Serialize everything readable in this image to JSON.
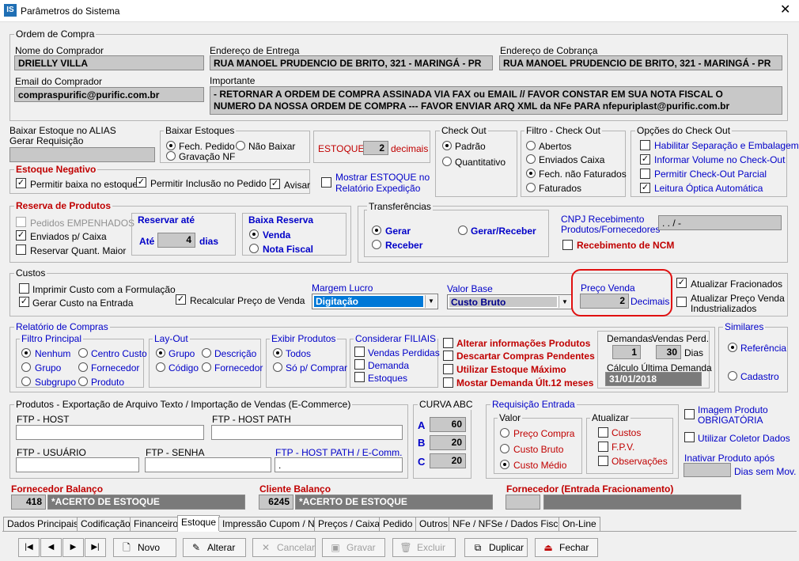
{
  "window": {
    "title": "Parâmetros do Sistema",
    "icon_text": "IS",
    "close": "✕"
  },
  "ordem_compra": {
    "title": "Ordem de Compra",
    "nome_label": "Nome do Comprador",
    "nome_value": "DRIELLY VILLA",
    "entrega_label": "Endereço de Entrega",
    "entrega_value": "RUA MANOEL PRUDENCIO DE BRITO, 321 - MARINGÁ - PR",
    "cobranca_label": "Endereço de Cobrança",
    "cobranca_value": "RUA MANOEL PRUDENCIO DE BRITO, 321 - MARINGÁ - PR",
    "email_label": "Email do Comprador",
    "email_value": "compraspurific@purific.com.br",
    "importante_label": "Importante",
    "importante_line1": "- RETORNAR A ORDEM DE COMPRA ASSINADA VIA FAX ou EMAIL //  FAVOR CONSTAR EM SUA NOTA FISCAL O",
    "importante_line2": "NUMERO DA NOSSA ORDEM DE COMPRA  ---  FAVOR ENVIAR ARQ XML da NFe PARA nfepuriplast@purific.com.br"
  },
  "baixar_alias": {
    "label1": "Baixar Estoque no ALIAS",
    "label2": "Gerar Requisição"
  },
  "baixar_estoques": {
    "title": "Baixar Estoques",
    "opt1": "Fech. Pedido",
    "opt2": "Não Baixar",
    "opt3": "Gravação NF"
  },
  "estoque": {
    "label": "ESTOQUE",
    "value": "2",
    "suffix": "decimais"
  },
  "checkout": {
    "title": "Check Out",
    "opt1": "Padrão",
    "opt2": "Quantitativo"
  },
  "filtro_checkout": {
    "title": "Filtro - Check Out",
    "opt1": "Abertos",
    "opt2": "Enviados Caixa",
    "opt3": "Fech. não Faturados",
    "opt4": "Faturados"
  },
  "opcoes_checkout": {
    "title": "Opções do Check Out",
    "opt1": "Habilitar Separação e Embalagem",
    "opt2": "Informar Volume no Check-Out",
    "opt3": "Permitir Check-Out Parcial",
    "opt4": "Leitura Óptica Automática"
  },
  "estoque_negativo": {
    "title": "Estoque Negativo",
    "opt1": "Permitir baixa no estoque",
    "opt2": "Permitir Inclusão no Pedido",
    "opt3": "Avisar"
  },
  "mostrar_estoque": {
    "line1": "Mostrar ESTOQUE no",
    "line2": "Relatório Expedição"
  },
  "reserva": {
    "title": "Reserva de Produtos",
    "opt1": "Pedidos EMPENHADOS",
    "opt2": "Enviados p/ Caixa",
    "opt3": "Reservar Quant. Maior",
    "ate_title": "Reservar até",
    "ate_label": "Até",
    "ate_value": "4",
    "ate_suffix": "dias",
    "baixa_title": "Baixa Reserva",
    "baixa_opt1": "Venda",
    "baixa_opt2": "Nota Fiscal"
  },
  "transferencias": {
    "title": "Transferências",
    "opt1": "Gerar",
    "opt2": "Gerar/Receber",
    "opt3": "Receber"
  },
  "cnpj": {
    "line1": "CNPJ Recebimento",
    "line2": "Produtos/Fornecedores",
    "value": " .  .  /  -",
    "ncm": "Recebimento de NCM"
  },
  "custos": {
    "title": "Custos",
    "opt1": "Imprimir Custo com a Formulação",
    "opt2": "Gerar Custo na Entrada",
    "opt3": "Recalcular Preço de Venda",
    "margem_label": "Margem Lucro",
    "margem_value": "Digitação",
    "base_label": "Valor Base",
    "base_value": "Custo Bruto",
    "preco_label": "Preço Venda",
    "preco_value": "2",
    "preco_suffix": "Decimais",
    "atualizar1": "Atualizar Fracionados",
    "atualizar2a": "Atualizar Preço Venda",
    "atualizar2b": "Industrializados"
  },
  "relatorio": {
    "title": "Relatório de Compras",
    "filtro_title": "Filtro Principal",
    "f1": "Nenhum",
    "f2": "Centro Custo",
    "f3": "Grupo",
    "f4": "Fornecedor",
    "f5": "Subgrupo",
    "f6": "Produto",
    "layout_title": "Lay-Out",
    "l1": "Grupo",
    "l2": "Descrição",
    "l3": "Código",
    "l4": "Fornecedor",
    "exibir_title": "Exibir Produtos",
    "e1": "Todos",
    "e2": "Só p/ Comprar",
    "filiais_title": "Considerar FILIAIS",
    "c1": "Vendas Perdidas",
    "c2": "Demanda",
    "c3": "Estoques",
    "a1": "Alterar informações Produtos",
    "a2": "Descartar Compras Pendentes",
    "a3": "Utilizar Estoque Máximo",
    "a4": "Mostar Demanda Últ.12 meses",
    "demandas_label": "Demandas",
    "demandas_value": "1",
    "vendas_label": "Vendas Perd.",
    "vendas_value": "30",
    "dias": "Dias",
    "calc_label": "Cálculo Última Demanda",
    "calc_value": "31/01/2018"
  },
  "similares": {
    "title": "Similares",
    "opt1": "Referência",
    "opt2": "Cadastro"
  },
  "produtos_export": {
    "title": "Produtos - Exportação de Arquivo Texto / Importação de Vendas (E-Commerce)",
    "ftp_host": "FTP -  HOST",
    "ftp_path": "FTP - HOST PATH",
    "ftp_user": "FTP -  USUÁRIO",
    "ftp_senha": "FTP -  SENHA",
    "ftp_path2": "FTP - HOST PATH / E-Comm.",
    "ftp_path2_value": "."
  },
  "curva": {
    "title": "CURVA ABC",
    "a_label": "A",
    "a_value": "60",
    "b_label": "B",
    "b_value": "20",
    "c_label": "C",
    "c_value": "20"
  },
  "requisicao": {
    "title": "Requisição Entrada",
    "valor_title": "Valor",
    "v1": "Preço Compra",
    "v2": "Custo Bruto",
    "v3": "Custo Médio",
    "atual_title": "Atualizar",
    "a1": "Custos",
    "a2": "F.P.V.",
    "a3": "Observações"
  },
  "imagem": {
    "line1": "Imagem Produto",
    "line2": "OBRIGATÓRIA",
    "coletor": "Utilizar Coletor Dados",
    "inativar": "Inativar Produto após",
    "dias": "Dias sem Mov."
  },
  "balanco": {
    "forn_label": "Fornecedor Balanço",
    "forn_code": "418",
    "forn_name": "*ACERTO DE ESTOQUE",
    "cli_label": "Cliente Balanço",
    "cli_code": "6245",
    "cli_name": "*ACERTO DE ESTOQUE",
    "frac_label": "Fornecedor (Entrada Fracionamento)"
  },
  "tabs": [
    "Dados Principais",
    "Codificação",
    "Financeiro",
    "Estoque",
    "Impressão Cupom / NF",
    "Preços / Caixa",
    "Pedido",
    "Outros",
    "NFe / NFSe / Dados Fisco",
    "On-Line"
  ],
  "toolbar": {
    "first": "|◀",
    "prev": "◀",
    "next": "▶",
    "last": "▶|",
    "novo": "Novo",
    "alterar": "Alterar",
    "cancelar": "Cancelar",
    "gravar": "Gravar",
    "excluir": "Excluir",
    "duplicar": "Duplicar",
    "fechar": "Fechar"
  },
  "colors": {
    "accent_blue": "#0000c8",
    "accent_red": "#c00000",
    "highlight": "#e01010"
  }
}
